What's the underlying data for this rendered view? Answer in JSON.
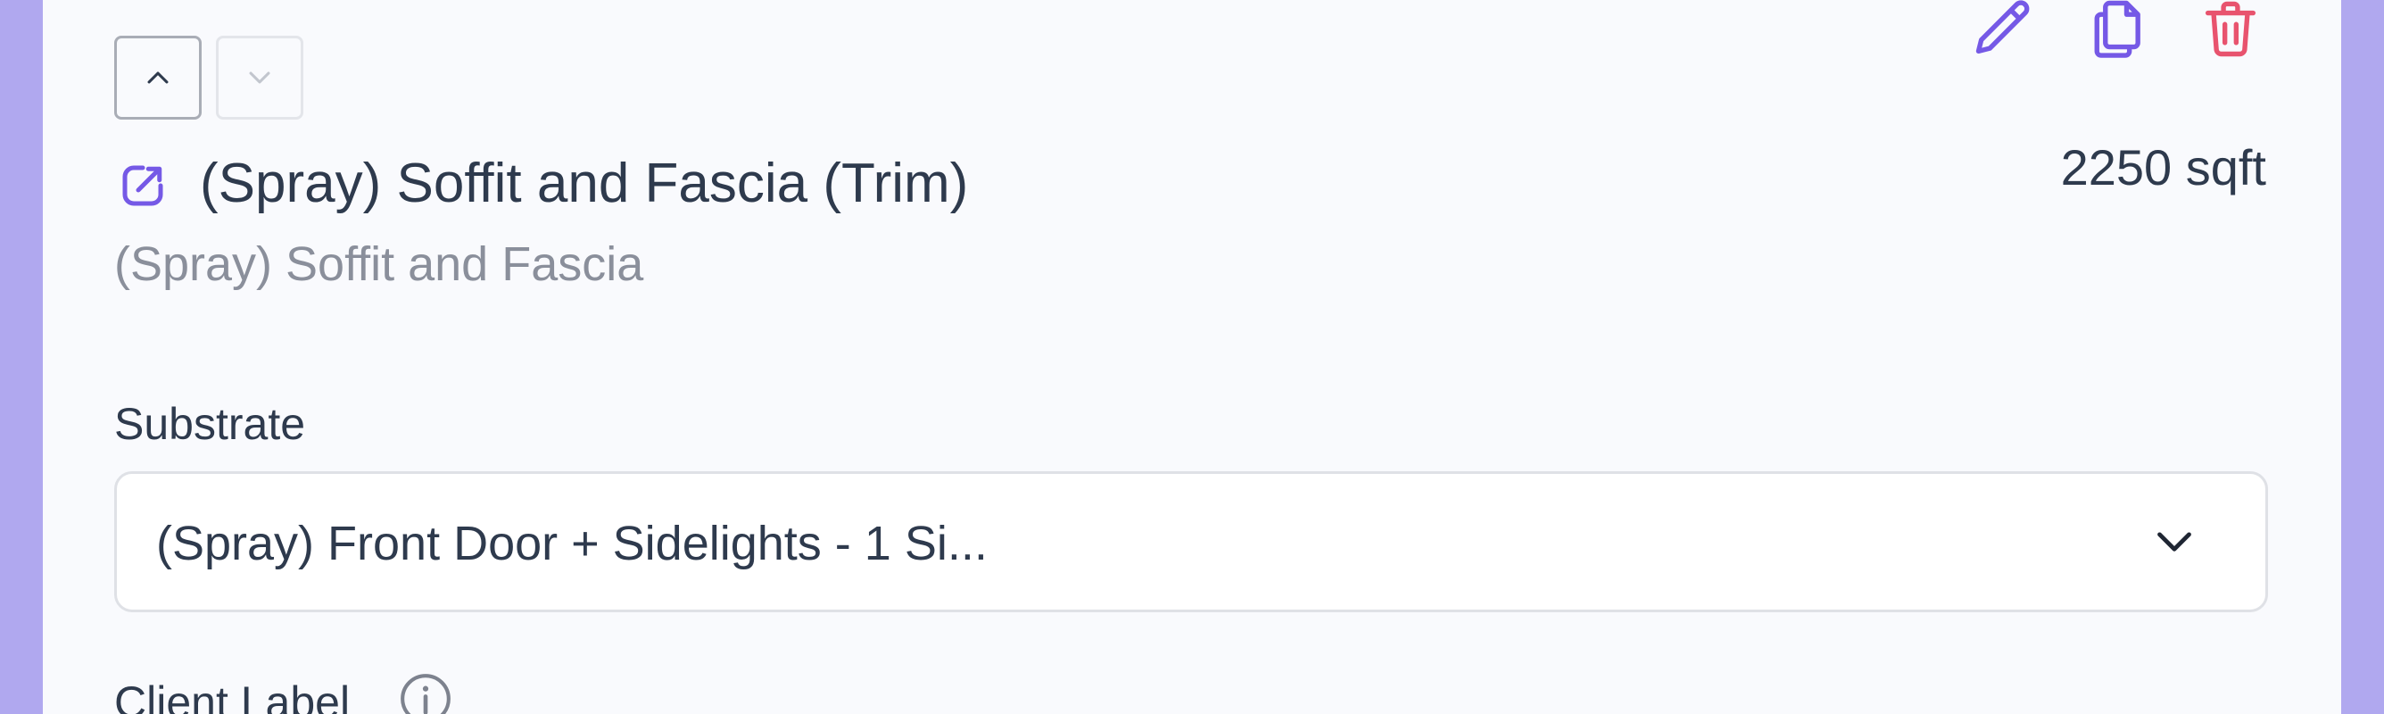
{
  "item": {
    "title": "(Spray) Soffit and Fascia (Trim)",
    "subtitle": "(Spray) Soffit and Fascia",
    "area": "2250 sqft"
  },
  "actions": {
    "edit_icon": "pencil-icon",
    "copy_icon": "copy-icon",
    "delete_icon": "trash-icon"
  },
  "sort": {
    "up_icon": "chevron-up-icon",
    "down_icon": "chevron-down-icon"
  },
  "substrate": {
    "label": "Substrate",
    "selected": "(Spray) Front Door + Sidelights - 1 Si..."
  },
  "client_label": {
    "label": "Client Label"
  },
  "colors": {
    "page_background": "#b0a8ef",
    "card_background": "#f9fafd",
    "accent": "#7559e6",
    "danger": "#e8536e",
    "text": "#2e3a4d",
    "muted_text": "#8a8f9b"
  }
}
